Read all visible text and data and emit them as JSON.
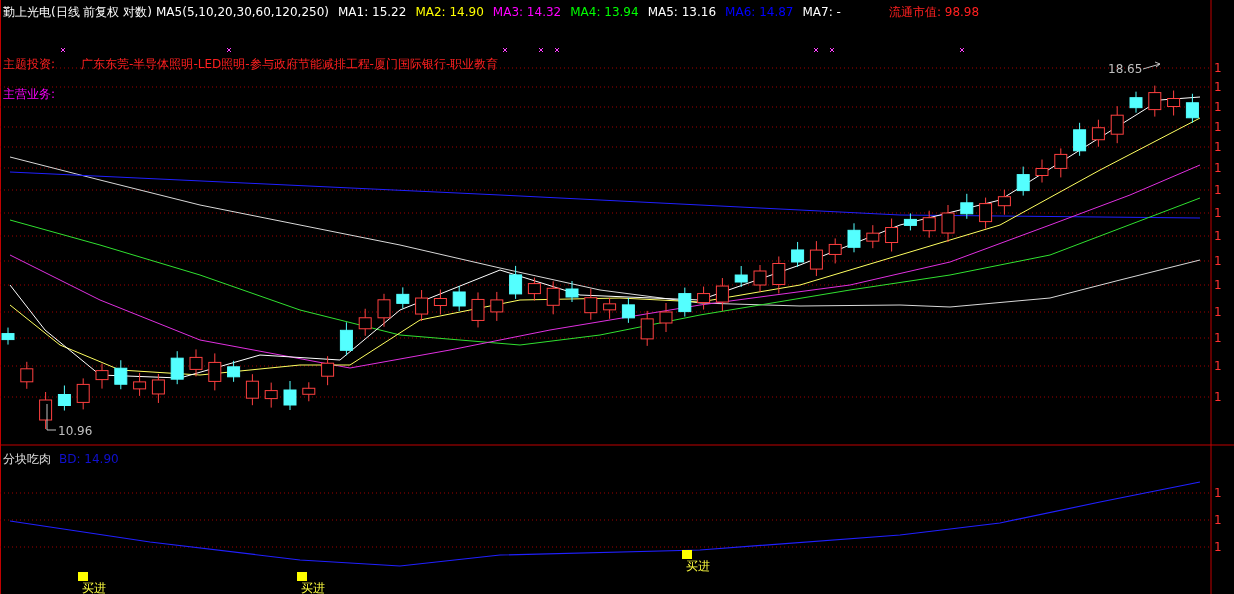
{
  "header": {
    "title": "勤上光电(日线 前复权 对数)",
    "ma_params": "MA5(5,10,20,30,60,120,250)",
    "indicators": [
      {
        "label": "MA1: 15.22",
        "color": "#ffffff"
      },
      {
        "label": "MA2: 14.90",
        "color": "#ffff00"
      },
      {
        "label": "MA3: 14.32",
        "color": "#ff00ff"
      },
      {
        "label": "MA4: 13.94",
        "color": "#00ff00"
      },
      {
        "label": "MA5: 13.16",
        "color": "#ffffff"
      },
      {
        "label": "MA6: 14.87",
        "color": "#0000ff"
      },
      {
        "label": "MA7: -",
        "color": "#ffffff"
      }
    ],
    "market_cap": "流通市值: 98.98"
  },
  "info": [
    {
      "label": "主题投资:",
      "value": "广东东莞-半导体照明-LED照明-参与政府节能减排工程-厦门国际银行-职业教育"
    },
    {
      "label": "主营业务:"
    }
  ],
  "price_axis": [
    "1",
    "1",
    "1",
    "1",
    "1",
    "1",
    "1",
    "1",
    "1",
    "1",
    "1",
    "1",
    "1",
    "1",
    "1"
  ],
  "annotations": {
    "high": "18.65",
    "low": "10.96"
  },
  "lower_panel": {
    "title": "分块吃肉",
    "reading": "BD: 14.90",
    "axis": [
      "1",
      "1",
      "1"
    ],
    "signals": [
      {
        "label": "买进"
      },
      {
        "label": "买进"
      },
      {
        "label": "买进"
      }
    ]
  }
}
